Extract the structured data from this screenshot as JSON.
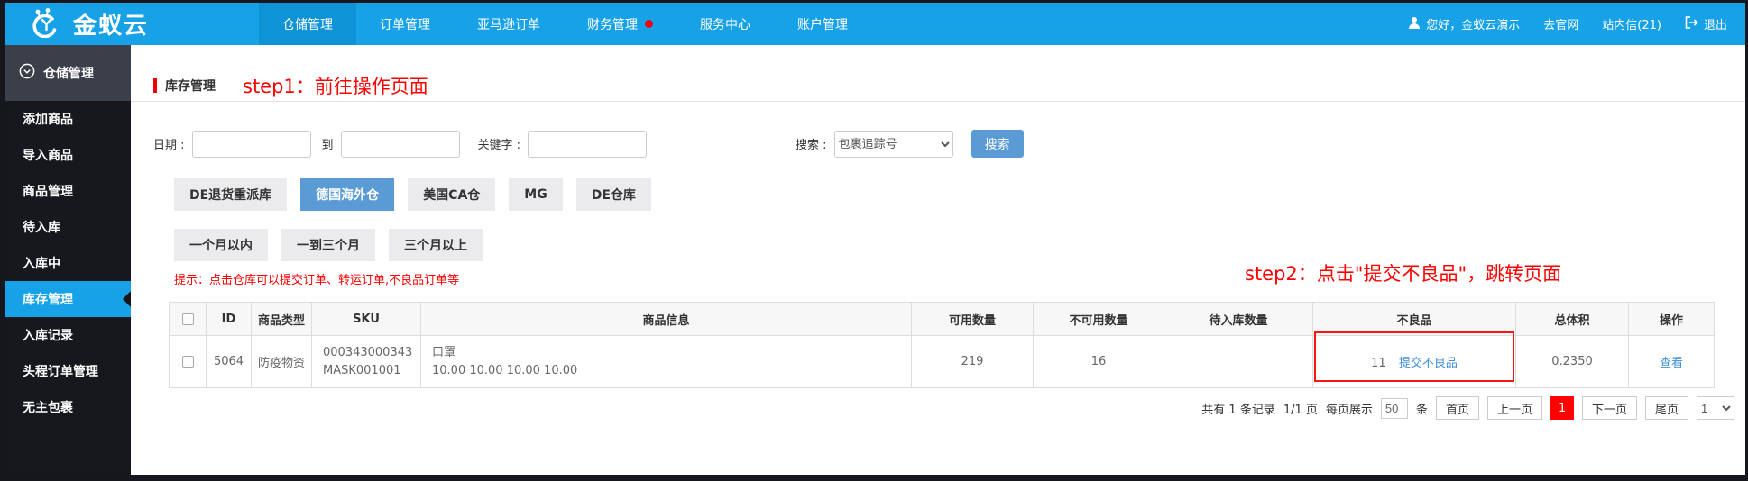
{
  "topbar": {
    "logo_text": "金蚁云",
    "nav": [
      {
        "label": "仓储管理"
      },
      {
        "label": "订单管理"
      },
      {
        "label": "亚马逊订单"
      },
      {
        "label": "财务管理"
      },
      {
        "label": "服务中心"
      },
      {
        "label": "账户管理"
      }
    ],
    "greeting": "您好，金蚁云演示",
    "go_official": "去官网",
    "site_mail": "站内信(21)",
    "logout": "退出"
  },
  "sidebar": {
    "header": "仓储管理",
    "items": [
      {
        "label": "添加商品"
      },
      {
        "label": "导入商品"
      },
      {
        "label": "商品管理"
      },
      {
        "label": "待入库"
      },
      {
        "label": "入库中"
      },
      {
        "label": "库存管理"
      },
      {
        "label": "入库记录"
      },
      {
        "label": "头程订单管理"
      },
      {
        "label": "无主包裹"
      }
    ]
  },
  "page": {
    "title": "库存管理",
    "step1": "step1：前往操作页面",
    "step2": "step2：点击\"提交不良品\"，跳转页面",
    "hint": "提示：点击仓库可以提交订单、转运订单,不良品订单等"
  },
  "filters": {
    "date_label": "日期 :",
    "to_label": "到",
    "keyword_label": "关键字 :",
    "search_label": "搜索 :",
    "search_type_selected": "包裹追踪号",
    "search_button": "搜索"
  },
  "warehouse_tabs": [
    {
      "label": "DE退货重派库"
    },
    {
      "label": "德国海外仓"
    },
    {
      "label": "美国CA仓"
    },
    {
      "label": "MG"
    },
    {
      "label": "DE仓库"
    }
  ],
  "age_tabs": [
    {
      "label": "一个月以内"
    },
    {
      "label": "一到三个月"
    },
    {
      "label": "三个月以上"
    }
  ],
  "table": {
    "headers": {
      "id": "ID",
      "type": "商品类型",
      "sku": "SKU",
      "info": "商品信息",
      "available": "可用数量",
      "unavailable": "不可用数量",
      "pending_in": "待入库数量",
      "defective": "不良品",
      "volume": "总体积",
      "action": "操作"
    },
    "row": {
      "id": "5064",
      "type": "防疫物资",
      "sku_code": "000343000343",
      "sku_name": "MASK001001",
      "info_name": "口罩",
      "info_dims": "10.00 10.00 10.00 10.00",
      "available": "219",
      "unavailable": "16",
      "pending_in": "",
      "defective_count": "11",
      "defective_link": "提交不良品",
      "volume": "0.2350",
      "action": "查看"
    }
  },
  "pagination": {
    "total_text": "共有 1 条记录",
    "page_text": "1/1 页",
    "per_page_label": "每页展示",
    "page_size": "50",
    "unit_label": "条",
    "first": "首页",
    "prev": "上一页",
    "current": "1",
    "next": "下一页",
    "last": "尾页",
    "jump_value": "1"
  },
  "colors": {
    "topbar_blue": "#17a2e8",
    "accent_blue": "#5b9bd5",
    "annotation_red": "#fe0000",
    "link_blue": "#3e8fd8",
    "pagination_active_red": "#fe0101"
  }
}
